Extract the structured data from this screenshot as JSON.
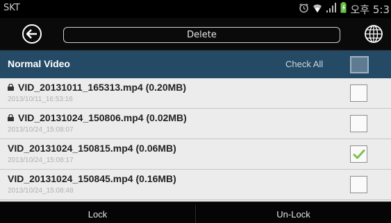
{
  "statusbar": {
    "carrier": "SKT",
    "time": "오후 5:3"
  },
  "titlebar": {
    "title": "Delete",
    "back_icon": "back-arrow-icon",
    "globe_icon": "globe-icon"
  },
  "section": {
    "label": "Normal Video",
    "check_all": "Check All",
    "check_all_checked": false
  },
  "files": [
    {
      "name": "VID_20131011_165313.mp4 (0.20MB)",
      "date": "2013/10/11_16:53:16",
      "locked": true,
      "checked": false
    },
    {
      "name": "VID_20131024_150806.mp4 (0.02MB)",
      "date": "2013/10/24_15:08:07",
      "locked": true,
      "checked": false
    },
    {
      "name": "VID_20131024_150815.mp4 (0.06MB)",
      "date": "2013/10/24_15:08:17",
      "locked": false,
      "checked": true
    },
    {
      "name": "VID_20131024_150845.mp4 (0.16MB)",
      "date": "2013/10/24_15:08:48",
      "locked": false,
      "checked": false
    }
  ],
  "bottombar": {
    "lock": "Lock",
    "unlock": "Un-Lock"
  },
  "colors": {
    "header_bg": "#244a66",
    "check_green": "#7cc24a"
  }
}
